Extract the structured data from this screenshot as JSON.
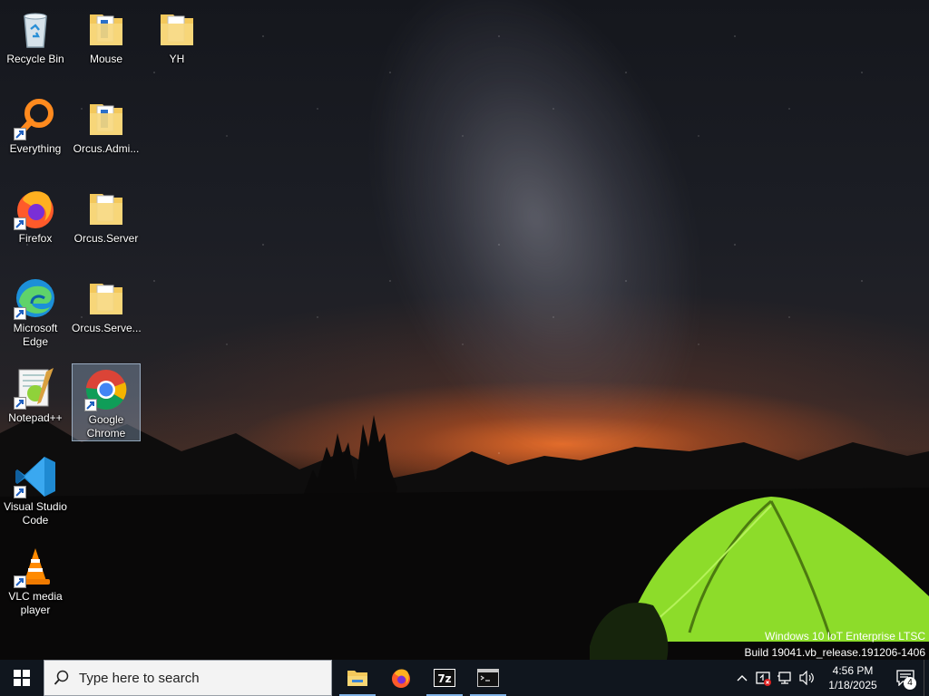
{
  "desktop": {
    "icons": [
      {
        "label": "Recycle Bin",
        "icon": "recycle-bin-icon",
        "shortcut": false
      },
      {
        "label": "Everything",
        "icon": "everything-icon",
        "shortcut": true
      },
      {
        "label": "Firefox",
        "icon": "firefox-icon",
        "shortcut": true
      },
      {
        "label": "Microsoft Edge",
        "icon": "edge-icon",
        "shortcut": true
      },
      {
        "label": "Notepad++",
        "icon": "notepadpp-icon",
        "shortcut": true
      },
      {
        "label": "Visual Studio Code",
        "icon": "vscode-icon",
        "shortcut": true
      },
      {
        "label": "VLC media player",
        "icon": "vlc-icon",
        "shortcut": true
      },
      {
        "label": "Mouse",
        "icon": "folder-icon",
        "shortcut": false
      },
      {
        "label": "Orcus.Admi...",
        "icon": "folder-icon",
        "shortcut": false
      },
      {
        "label": "Orcus.Server",
        "icon": "folder-icon",
        "shortcut": false
      },
      {
        "label": "Orcus.Serve...",
        "icon": "folder-icon",
        "shortcut": false
      },
      {
        "label": "Google Chrome",
        "icon": "chrome-icon",
        "shortcut": true,
        "selected": true
      },
      {
        "label": "YH",
        "icon": "folder-icon",
        "shortcut": false
      }
    ]
  },
  "watermark": {
    "line1": "Windows 10 IoT Enterprise LTSC",
    "line2": "Build 19041.vb_release.191206-1406"
  },
  "taskbar": {
    "search_placeholder": "Type here to search",
    "apps": [
      {
        "name": "File Explorer",
        "icon": "file-explorer-icon",
        "running": true
      },
      {
        "name": "Firefox",
        "icon": "firefox-icon",
        "running": false
      },
      {
        "name": "7-Zip",
        "icon": "7zip-icon",
        "running": true
      },
      {
        "name": "Command Prompt",
        "icon": "terminal-icon",
        "running": true
      }
    ],
    "clock": {
      "time": "4:56 PM",
      "date": "1/18/2025"
    },
    "notification_count": "4"
  },
  "colors": {
    "taskbar": "#10161e",
    "selection": "#a0bedc",
    "folder": "#f3c85b",
    "tent": "#8ddc2a"
  }
}
